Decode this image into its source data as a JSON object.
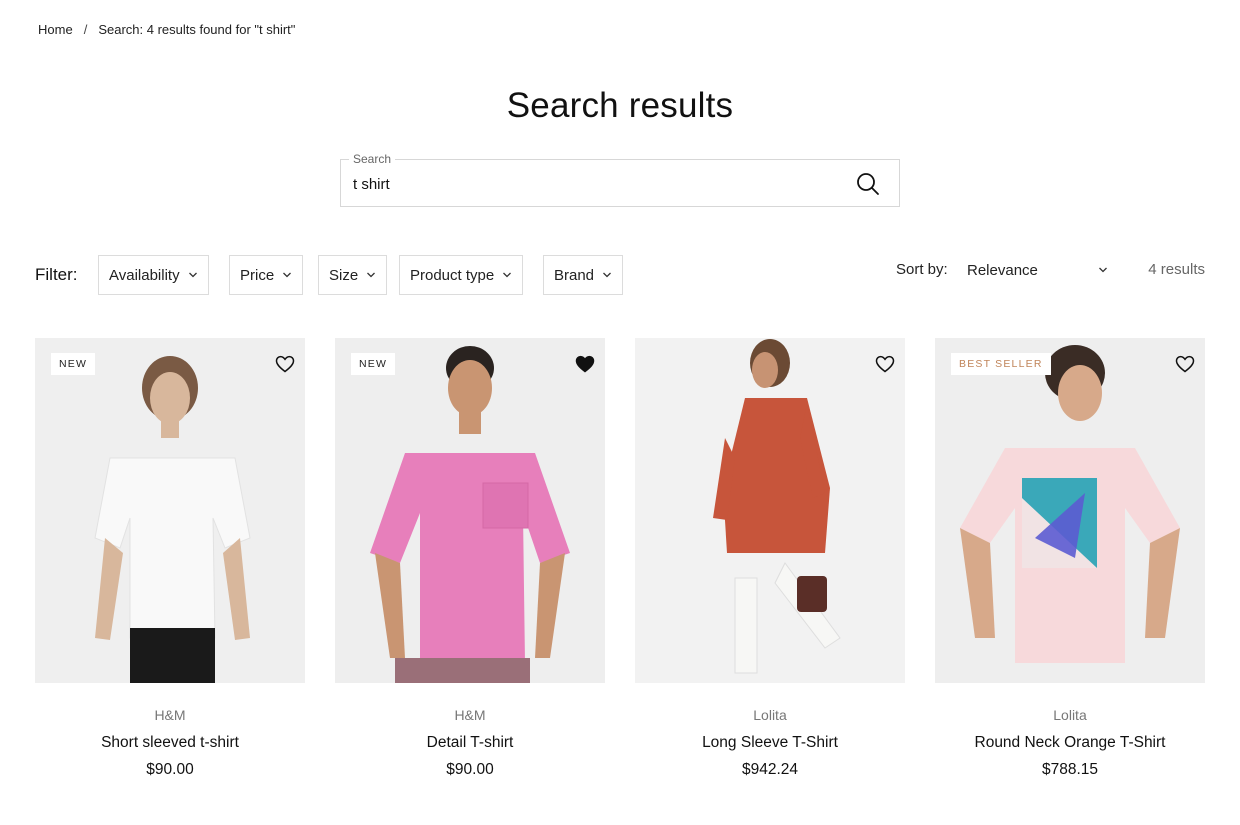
{
  "breadcrumb": {
    "home": "Home",
    "separator": "/",
    "current": "Search: 4 results found for \"t shirt\""
  },
  "page_title": "Search results",
  "search": {
    "legend": "Search",
    "value": "t shirt"
  },
  "filters": {
    "label": "Filter:",
    "items": [
      "Availability",
      "Price",
      "Size",
      "Product type",
      "Brand"
    ]
  },
  "sort": {
    "label": "Sort by:",
    "selected": "Relevance",
    "results_count": "4 results"
  },
  "products": [
    {
      "badge": "NEW",
      "brand": "H&M",
      "title": "Short sleeved t-shirt",
      "price": "$90.00",
      "wishlisted": false
    },
    {
      "badge": "NEW",
      "brand": "H&M",
      "title": "Detail T-shirt",
      "price": "$90.00",
      "wishlisted": true
    },
    {
      "badge": "",
      "brand": "Lolita",
      "title": "Long Sleeve T-Shirt",
      "price": "$942.24",
      "wishlisted": false
    },
    {
      "badge": "BEST SELLER",
      "brand": "Lolita",
      "title": "Round Neck Orange T-Shirt",
      "price": "$788.15",
      "wishlisted": false
    }
  ],
  "colors": {
    "accent_badge": "#c08459",
    "border": "#dcdcdc",
    "image_bg": "#eeeeee"
  },
  "icons": [
    "search-icon",
    "chevron-down-icon",
    "heart-outline-icon",
    "heart-filled-icon"
  ]
}
